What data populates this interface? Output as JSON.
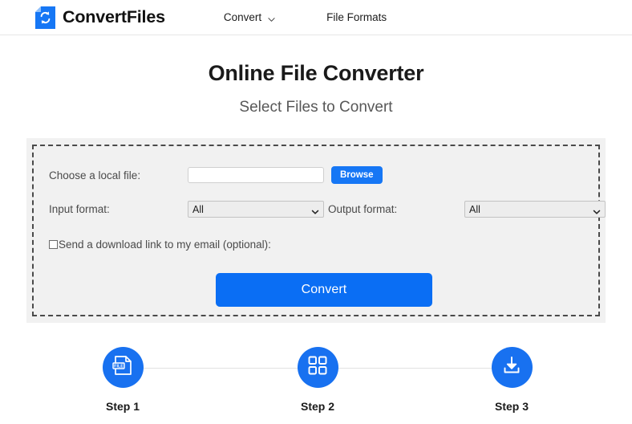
{
  "header": {
    "brand_name": "ConvertFiles",
    "brand_icon": "file-convert-logo-icon",
    "nav": [
      {
        "label": "Convert",
        "icon": "chevron-down-icon",
        "has_caret": true
      },
      {
        "label": "File Formats",
        "has_caret": false
      }
    ]
  },
  "hero": {
    "title": "Online File Converter",
    "subtitle": "Select Files to Convert"
  },
  "form": {
    "choose_file_label": "Choose a local file:",
    "file_input_value": "",
    "file_input_placeholder": "",
    "browse_label": "Browse",
    "input_format_label": "Input format:",
    "input_format_value": "All",
    "input_format_options": [
      "All"
    ],
    "output_format_label": "Output format:",
    "output_format_value": "All",
    "output_format_options": [
      "All"
    ],
    "email_checkbox_checked": false,
    "email_label": "Send a download link to my email (optional):",
    "convert_label": "Convert"
  },
  "steps": [
    {
      "label": "Step 1",
      "icon": "file-document-icon"
    },
    {
      "label": "Step 2",
      "icon": "grid-squares-icon"
    },
    {
      "label": "Step 3",
      "icon": "download-tray-icon"
    }
  ],
  "colors": {
    "brand_blue": "#1677f5",
    "convert_blue": "#0a6ef4",
    "step_blue": "#1871f0",
    "panel_gray": "#f1f1f1",
    "dash_border": "#4a4a4a"
  }
}
